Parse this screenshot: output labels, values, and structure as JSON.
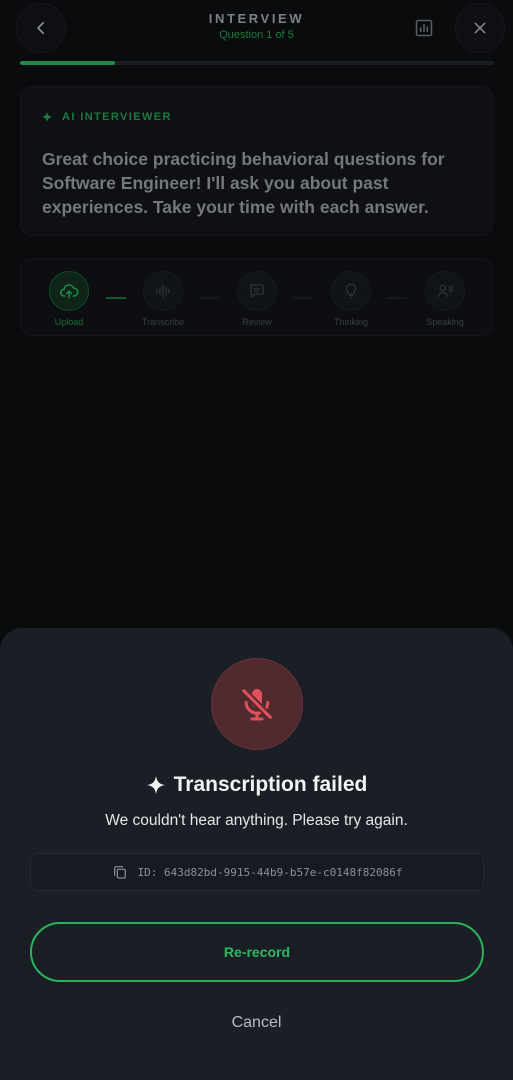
{
  "header": {
    "title": "INTERVIEW",
    "subtitle": "Question 1 of 5",
    "progress_fraction": 0.2
  },
  "ai_card": {
    "label": "AI INTERVIEWER",
    "message": "Great choice practicing behavioral questions for Software Engineer! I'll ask you about past experiences. Take your time with each answer."
  },
  "steps": [
    {
      "label": "Upload",
      "icon": "cloud-upload-icon",
      "active": true
    },
    {
      "label": "Transcribe",
      "icon": "waveform-icon",
      "active": false
    },
    {
      "label": "Review",
      "icon": "chat-review-icon",
      "active": false
    },
    {
      "label": "Thinking",
      "icon": "lightbulb-icon",
      "active": false
    },
    {
      "label": "Speaking",
      "icon": "speaking-person-icon",
      "active": false
    }
  ],
  "sheet": {
    "title": "Transcription failed",
    "message": "We couldn't hear anything. Please try again.",
    "id_text": "ID: 643d82bd-9915-44b9-b57e-c0148f82086f",
    "rerecord_label": "Re-record",
    "cancel_label": "Cancel"
  },
  "colors": {
    "accent_green": "#2fb862",
    "error_red": "#e0505a",
    "sheet_bg": "#1a1f26"
  }
}
